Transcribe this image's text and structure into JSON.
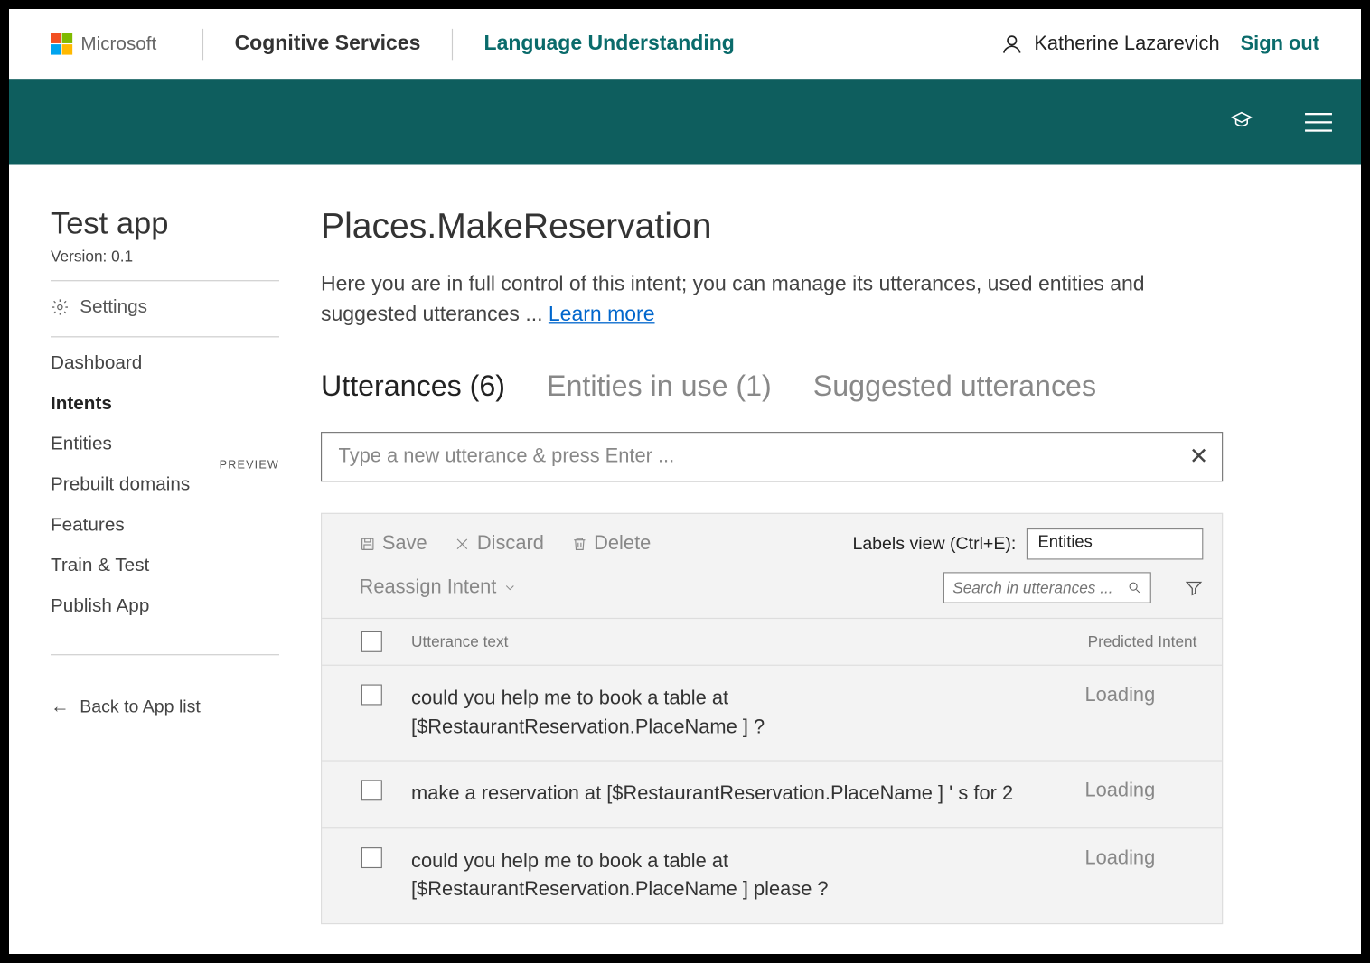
{
  "header": {
    "ms_label": "Microsoft",
    "service_label": "Cognitive Services",
    "product_label": "Language Understanding",
    "user_name": "Katherine Lazarevich",
    "signout_label": "Sign out"
  },
  "sidebar": {
    "app_title": "Test app",
    "version_label": "Version:  0.1",
    "settings_label": "Settings",
    "nav": {
      "dashboard": "Dashboard",
      "intents": "Intents",
      "entities": "Entities",
      "prebuilt": "Prebuilt domains",
      "preview_badge": "PREVIEW",
      "features": "Features",
      "train_test": "Train & Test",
      "publish": "Publish App"
    },
    "back_label": "Back to App list"
  },
  "main": {
    "title": "Places.MakeReservation",
    "desc_prefix": "Here you are in full control of this intent; you can manage its utterances, used entities and suggested utterances ... ",
    "learn_more": "Learn more",
    "tabs": {
      "utterances": "Utterances (6)",
      "entities": "Entities in use (1)",
      "suggested": "Suggested utterances"
    },
    "new_utterance_placeholder": "Type a new utterance & press Enter ...",
    "toolbar": {
      "save": "Save",
      "discard": "Discard",
      "delete": "Delete",
      "reassign": "Reassign Intent",
      "labels_view_label": "Labels view (Ctrl+E):",
      "labels_view_value": "Entities",
      "search_placeholder": "Search in utterances ..."
    },
    "table": {
      "col_text": "Utterance text",
      "col_pred": "Predicted Intent"
    },
    "rows": [
      {
        "text": "could you help me to book a table at [$RestaurantReservation.PlaceName ] ?",
        "pred": "Loading"
      },
      {
        "text": "make a reservation at [$RestaurantReservation.PlaceName ] ' s for 2",
        "pred": "Loading"
      },
      {
        "text": "could you help me to book a table at [$RestaurantReservation.PlaceName ] please ?",
        "pred": "Loading"
      }
    ]
  }
}
